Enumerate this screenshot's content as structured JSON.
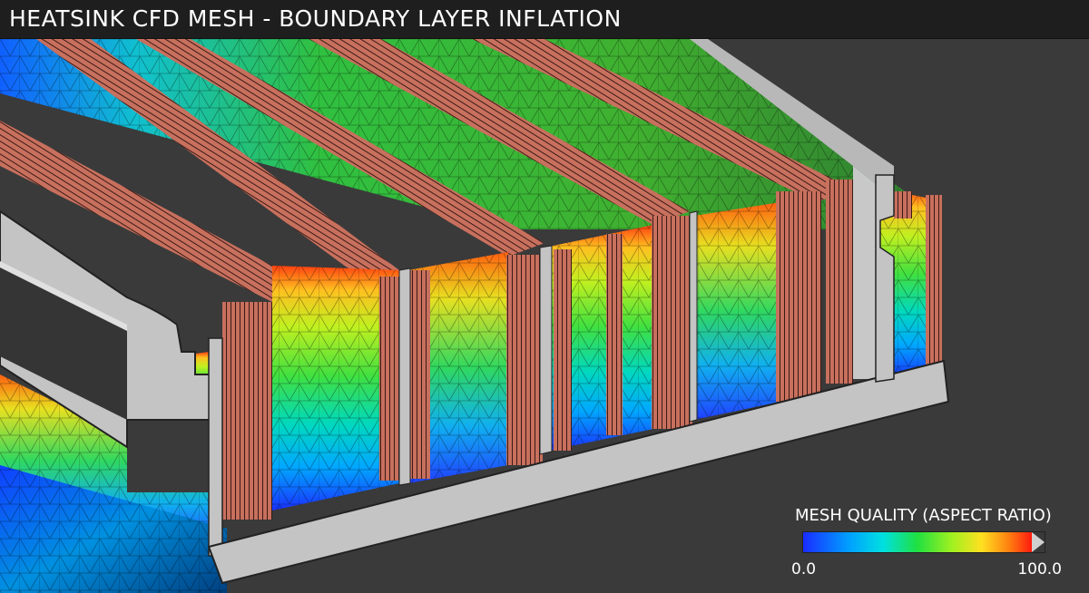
{
  "header": {
    "title": "HEATSINK CFD MESH - BOUNDARY LAYER INFLATION"
  },
  "legend": {
    "title": "MESH QUALITY (ASPECT RATIO)",
    "min_label": "0.0",
    "max_label": "100.0",
    "colormap": [
      "#1a2cff",
      "#00a0ff",
      "#00e0e0",
      "#20e040",
      "#a0f020",
      "#ffe020",
      "#ff8010",
      "#ff1a10"
    ]
  },
  "colors": {
    "background": "#3a3a3a",
    "title_bar": "#1e1e1e",
    "solid_body": "#c8c8c8",
    "inflation_layer": "#c87060"
  }
}
